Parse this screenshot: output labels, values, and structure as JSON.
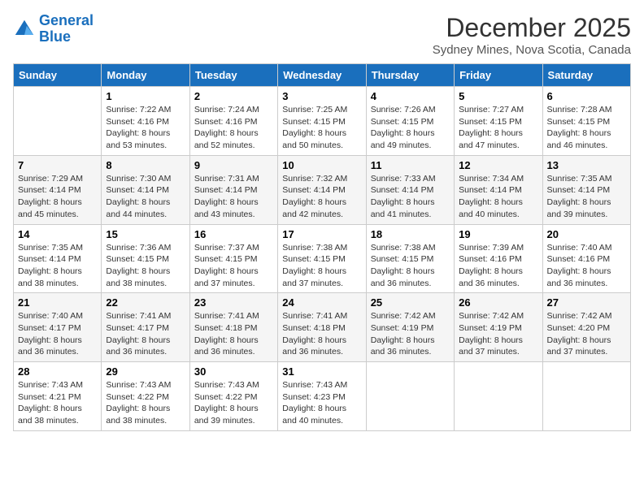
{
  "header": {
    "logo_line1": "General",
    "logo_line2": "Blue",
    "title": "December 2025",
    "subtitle": "Sydney Mines, Nova Scotia, Canada"
  },
  "days_of_week": [
    "Sunday",
    "Monday",
    "Tuesday",
    "Wednesday",
    "Thursday",
    "Friday",
    "Saturday"
  ],
  "weeks": [
    [
      {
        "num": "",
        "text": ""
      },
      {
        "num": "1",
        "text": "Sunrise: 7:22 AM\nSunset: 4:16 PM\nDaylight: 8 hours\nand 53 minutes."
      },
      {
        "num": "2",
        "text": "Sunrise: 7:24 AM\nSunset: 4:16 PM\nDaylight: 8 hours\nand 52 minutes."
      },
      {
        "num": "3",
        "text": "Sunrise: 7:25 AM\nSunset: 4:15 PM\nDaylight: 8 hours\nand 50 minutes."
      },
      {
        "num": "4",
        "text": "Sunrise: 7:26 AM\nSunset: 4:15 PM\nDaylight: 8 hours\nand 49 minutes."
      },
      {
        "num": "5",
        "text": "Sunrise: 7:27 AM\nSunset: 4:15 PM\nDaylight: 8 hours\nand 47 minutes."
      },
      {
        "num": "6",
        "text": "Sunrise: 7:28 AM\nSunset: 4:15 PM\nDaylight: 8 hours\nand 46 minutes."
      }
    ],
    [
      {
        "num": "7",
        "text": "Sunrise: 7:29 AM\nSunset: 4:14 PM\nDaylight: 8 hours\nand 45 minutes."
      },
      {
        "num": "8",
        "text": "Sunrise: 7:30 AM\nSunset: 4:14 PM\nDaylight: 8 hours\nand 44 minutes."
      },
      {
        "num": "9",
        "text": "Sunrise: 7:31 AM\nSunset: 4:14 PM\nDaylight: 8 hours\nand 43 minutes."
      },
      {
        "num": "10",
        "text": "Sunrise: 7:32 AM\nSunset: 4:14 PM\nDaylight: 8 hours\nand 42 minutes."
      },
      {
        "num": "11",
        "text": "Sunrise: 7:33 AM\nSunset: 4:14 PM\nDaylight: 8 hours\nand 41 minutes."
      },
      {
        "num": "12",
        "text": "Sunrise: 7:34 AM\nSunset: 4:14 PM\nDaylight: 8 hours\nand 40 minutes."
      },
      {
        "num": "13",
        "text": "Sunrise: 7:35 AM\nSunset: 4:14 PM\nDaylight: 8 hours\nand 39 minutes."
      }
    ],
    [
      {
        "num": "14",
        "text": "Sunrise: 7:35 AM\nSunset: 4:14 PM\nDaylight: 8 hours\nand 38 minutes."
      },
      {
        "num": "15",
        "text": "Sunrise: 7:36 AM\nSunset: 4:15 PM\nDaylight: 8 hours\nand 38 minutes."
      },
      {
        "num": "16",
        "text": "Sunrise: 7:37 AM\nSunset: 4:15 PM\nDaylight: 8 hours\nand 37 minutes."
      },
      {
        "num": "17",
        "text": "Sunrise: 7:38 AM\nSunset: 4:15 PM\nDaylight: 8 hours\nand 37 minutes."
      },
      {
        "num": "18",
        "text": "Sunrise: 7:38 AM\nSunset: 4:15 PM\nDaylight: 8 hours\nand 36 minutes."
      },
      {
        "num": "19",
        "text": "Sunrise: 7:39 AM\nSunset: 4:16 PM\nDaylight: 8 hours\nand 36 minutes."
      },
      {
        "num": "20",
        "text": "Sunrise: 7:40 AM\nSunset: 4:16 PM\nDaylight: 8 hours\nand 36 minutes."
      }
    ],
    [
      {
        "num": "21",
        "text": "Sunrise: 7:40 AM\nSunset: 4:17 PM\nDaylight: 8 hours\nand 36 minutes."
      },
      {
        "num": "22",
        "text": "Sunrise: 7:41 AM\nSunset: 4:17 PM\nDaylight: 8 hours\nand 36 minutes."
      },
      {
        "num": "23",
        "text": "Sunrise: 7:41 AM\nSunset: 4:18 PM\nDaylight: 8 hours\nand 36 minutes."
      },
      {
        "num": "24",
        "text": "Sunrise: 7:41 AM\nSunset: 4:18 PM\nDaylight: 8 hours\nand 36 minutes."
      },
      {
        "num": "25",
        "text": "Sunrise: 7:42 AM\nSunset: 4:19 PM\nDaylight: 8 hours\nand 36 minutes."
      },
      {
        "num": "26",
        "text": "Sunrise: 7:42 AM\nSunset: 4:19 PM\nDaylight: 8 hours\nand 37 minutes."
      },
      {
        "num": "27",
        "text": "Sunrise: 7:42 AM\nSunset: 4:20 PM\nDaylight: 8 hours\nand 37 minutes."
      }
    ],
    [
      {
        "num": "28",
        "text": "Sunrise: 7:43 AM\nSunset: 4:21 PM\nDaylight: 8 hours\nand 38 minutes."
      },
      {
        "num": "29",
        "text": "Sunrise: 7:43 AM\nSunset: 4:22 PM\nDaylight: 8 hours\nand 38 minutes."
      },
      {
        "num": "30",
        "text": "Sunrise: 7:43 AM\nSunset: 4:22 PM\nDaylight: 8 hours\nand 39 minutes."
      },
      {
        "num": "31",
        "text": "Sunrise: 7:43 AM\nSunset: 4:23 PM\nDaylight: 8 hours\nand 40 minutes."
      },
      {
        "num": "",
        "text": ""
      },
      {
        "num": "",
        "text": ""
      },
      {
        "num": "",
        "text": ""
      }
    ]
  ]
}
